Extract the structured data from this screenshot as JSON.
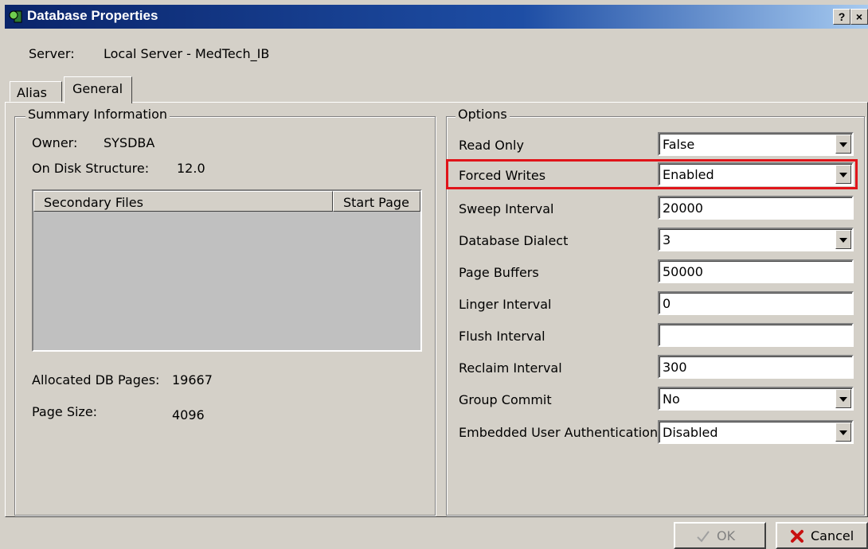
{
  "window": {
    "title": "Database Properties",
    "help_btn": "?",
    "close_btn": "×"
  },
  "server": {
    "label": "Server:",
    "value": "Local Server - MedTech_IB"
  },
  "tabs": [
    {
      "label": "Alias",
      "active": false
    },
    {
      "label": "General",
      "active": true
    }
  ],
  "summary": {
    "legend": "Summary Information",
    "owner_label": "Owner:",
    "owner_value": "SYSDBA",
    "ods_label": "On Disk Structure:",
    "ods_value": "12.0",
    "list_headers": [
      "Secondary Files",
      "Start Page"
    ],
    "allocated_label": "Allocated DB Pages:",
    "allocated_value": "19667",
    "pagesize_label": "Page Size:",
    "pagesize_value": "4096"
  },
  "options": {
    "legend": "Options",
    "rows": [
      {
        "label": "Read Only",
        "value": "False",
        "type": "dropdown"
      },
      {
        "label": "Forced Writes",
        "value": "Enabled",
        "type": "dropdown",
        "highlighted": true
      },
      {
        "label": "Sweep Interval",
        "value": "20000",
        "type": "text"
      },
      {
        "label": "Database Dialect",
        "value": "3",
        "type": "dropdown"
      },
      {
        "label": "Page Buffers",
        "value": "50000",
        "type": "text"
      },
      {
        "label": "Linger Interval",
        "value": "0",
        "type": "text"
      },
      {
        "label": "Flush Interval",
        "value": "",
        "type": "text"
      },
      {
        "label": "Reclaim Interval",
        "value": "300",
        "type": "text"
      },
      {
        "label": "Group Commit",
        "value": "No",
        "type": "dropdown"
      },
      {
        "label": "Embedded User Authentication",
        "value": "Disabled",
        "type": "dropdown"
      }
    ]
  },
  "buttons": {
    "ok": "OK",
    "cancel": "Cancel"
  },
  "colors": {
    "titlebar": "#0a246a",
    "dialog_bg": "#d4d0c8",
    "highlight": "#e0141a"
  }
}
